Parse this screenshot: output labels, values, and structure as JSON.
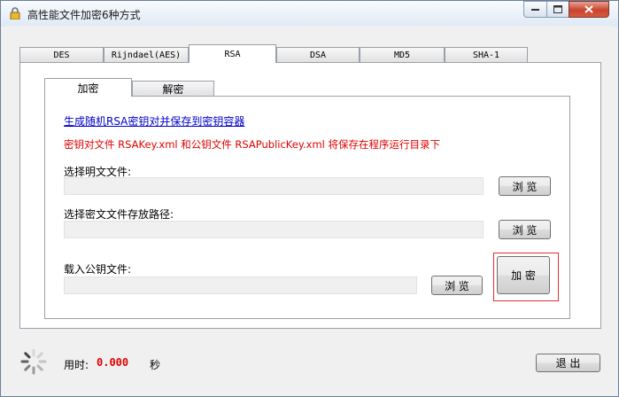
{
  "window": {
    "title": "高性能文件加密6种方式"
  },
  "tabs": [
    "DES",
    "Rijndael(AES)",
    "RSA",
    "DSA",
    "MD5",
    "SHA-1"
  ],
  "active_tab": "RSA",
  "subtabs": [
    "加密",
    "解密"
  ],
  "active_subtab": "加密",
  "rsa_encrypt": {
    "generate_link": "生成随机RSA密钥对并保存到密钥容器",
    "note": "密钥对文件 RSAKey.xml 和公钥文件 RSAPublicKey.xml 将保存在程序运行目录下",
    "plain_label": "选择明文文件:",
    "plain_value": "",
    "cipher_label": "选择密文文件存放路径:",
    "cipher_value": "",
    "pubkey_label": "载入公钥文件:",
    "pubkey_value": "",
    "browse_label": "浏 览",
    "encrypt_label": "加 密"
  },
  "status": {
    "time_label": "用时:",
    "time_value": "0.000",
    "unit": "秒"
  },
  "exit_label": "退 出",
  "colors": {
    "warning": "#e00000",
    "link": "#0000cc",
    "highlight": "#e03030"
  }
}
